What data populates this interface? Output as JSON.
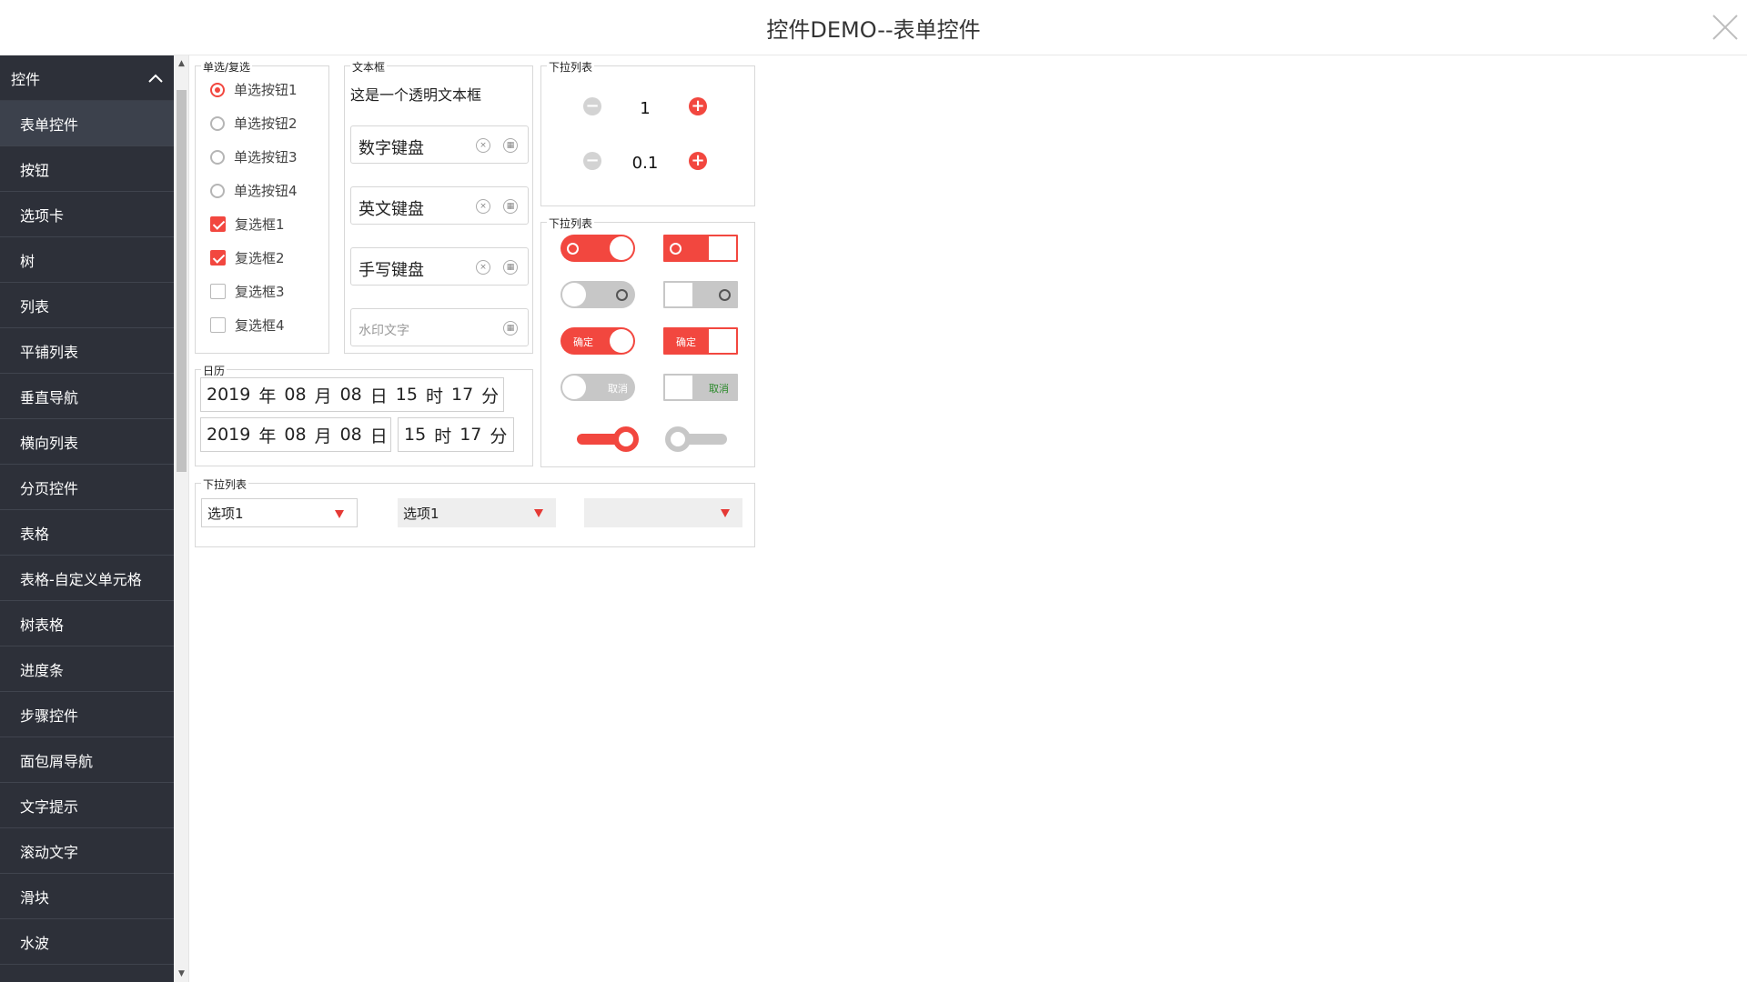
{
  "window": {
    "title": "控件DEMO--表单控件"
  },
  "sidebar": {
    "header": "控件",
    "items": [
      "表单控件",
      "按钮",
      "选项卡",
      "树",
      "列表",
      "平铺列表",
      "垂直导航",
      "横向列表",
      "分页控件",
      "表格",
      "表格-自定义单元格",
      "树表格",
      "进度条",
      "步骤控件",
      "面包屑导航",
      "文字提示",
      "滚动文字",
      "滑块",
      "水波"
    ],
    "active_index": 0
  },
  "groups": {
    "choice": {
      "label": "单选/复选",
      "radios": [
        {
          "label": "单选按钮1",
          "checked": true
        },
        {
          "label": "单选按钮2",
          "checked": false
        },
        {
          "label": "单选按钮3",
          "checked": false
        },
        {
          "label": "单选按钮4",
          "checked": false
        }
      ],
      "checks": [
        {
          "label": "复选框1",
          "checked": true
        },
        {
          "label": "复选框2",
          "checked": true
        },
        {
          "label": "复选框3",
          "checked": false
        },
        {
          "label": "复选框4",
          "checked": false
        }
      ]
    },
    "text": {
      "label": "文本框",
      "transparent": "这是一个透明文本框",
      "fields": [
        {
          "value": "数字键盘",
          "clearable": true
        },
        {
          "value": "英文键盘",
          "clearable": true
        },
        {
          "value": "手写键盘",
          "clearable": true
        },
        {
          "placeholder": "水印文字",
          "clearable": false
        }
      ]
    },
    "spinner": {
      "label": "下拉列表",
      "values": [
        "1",
        "0.1"
      ],
      "minus": "−",
      "plus": "+"
    },
    "switches": {
      "label": "下拉列表",
      "on_text": "确定",
      "off_text": "取消"
    },
    "calendar": {
      "label": "日历",
      "row1": [
        "2019",
        "年",
        "08",
        "月",
        "08",
        "日",
        "15",
        "时",
        "17",
        "分"
      ],
      "row2_date": [
        "2019",
        "年",
        "08",
        "月",
        "08",
        "日"
      ],
      "row2_time": [
        "15",
        "时",
        "17",
        "分"
      ]
    },
    "dropdowns": {
      "label": "下拉列表",
      "selects": [
        {
          "value": "选项1",
          "style": "white"
        },
        {
          "value": "选项1",
          "style": "grey"
        },
        {
          "value": "",
          "style": "grey"
        }
      ]
    }
  },
  "colors": {
    "accent": "#f2473f",
    "sidebar_bg": "#2d3039",
    "switch_off": "#c7c7c7"
  },
  "icons": {
    "close": "close-icon",
    "collapse": "chevron-up-icon",
    "clear": "clear-circle-icon",
    "keyboard": "keyboard-icon",
    "dropdown": "triangle-down-icon"
  }
}
